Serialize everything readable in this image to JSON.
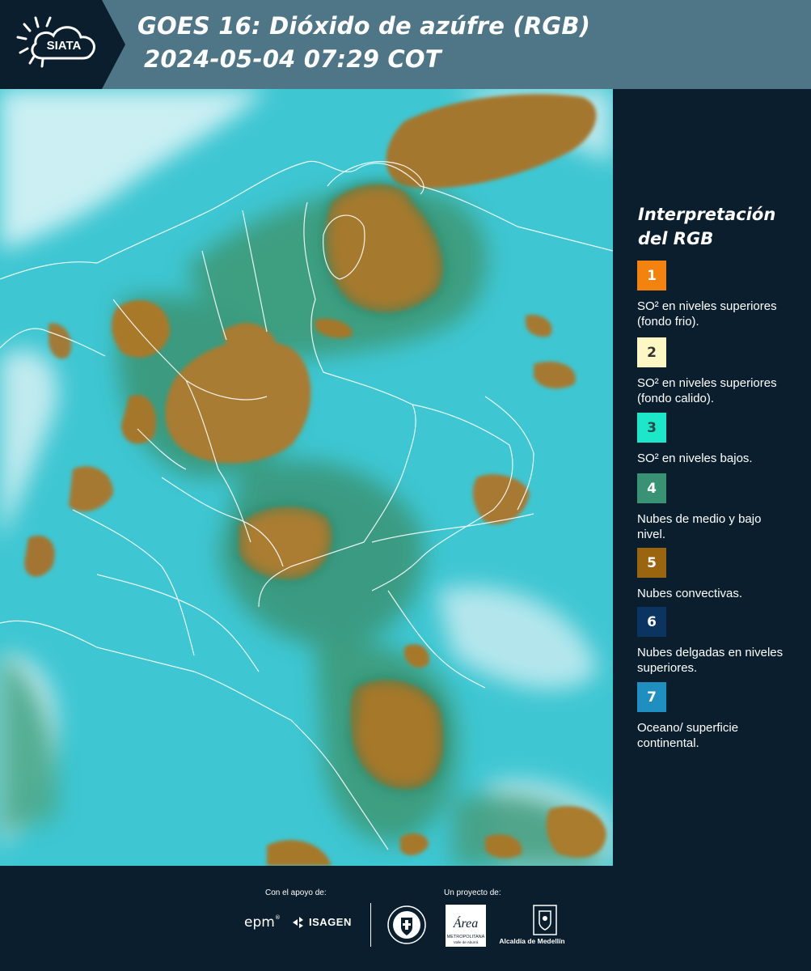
{
  "header": {
    "logo_text": "SIATA",
    "title_line1": "GOES 16: Dióxido de azúfre (RGB)",
    "title_line2": "2024-05-04 07:29 COT"
  },
  "legend": {
    "title": "Interpretación del RGB",
    "items": [
      {
        "number": "1",
        "color": "#f4820f",
        "description": "SO² en niveles superiores (fondo frio)."
      },
      {
        "number": "2",
        "color": "#fdf7c4",
        "description": "SO² en niveles superiores (fondo calido)."
      },
      {
        "number": "3",
        "color": "#1ce7c8",
        "description": "SO² en niveles bajos."
      },
      {
        "number": "4",
        "color": "#3a9275",
        "description": "Nubes de medio y bajo nivel."
      },
      {
        "number": "5",
        "color": "#9b6510",
        "description": "Nubes convectivas."
      },
      {
        "number": "6",
        "color": "#0c3461",
        "description": "Nubes delgadas en niveles superiores."
      },
      {
        "number": "7",
        "color": "#1e8fbf",
        "description": "Oceano/ superficie continental."
      }
    ]
  },
  "footer": {
    "support_label": "Con el apoyo de:",
    "project_label": "Un proyecto de:",
    "epm": "epm",
    "isagen": "ISAGEN",
    "area_name": "Área",
    "area_subtitle": "METROPOLITANA",
    "area_subtitle2": "Valle de Aburrá",
    "alcaldia": "Alcaldía de Medellín"
  },
  "colors": {
    "header_bg": "#4f7686",
    "panel_bg": "#0b1e2d",
    "cloud_convective": "#a9782c",
    "low_cloud": "#3c9b78",
    "surface": "#3ec6d2",
    "thin_cloud": "#dff6f8"
  }
}
